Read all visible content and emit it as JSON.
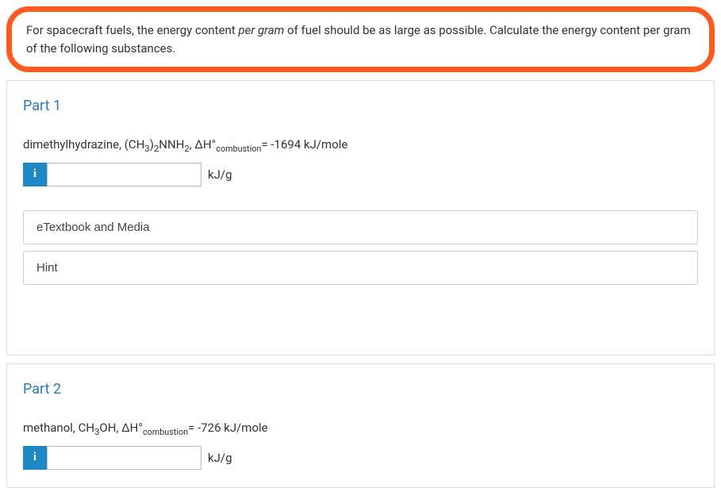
{
  "question": {
    "pre": "For spacecraft fuels, the energy content ",
    "italic": "per gram",
    "post": " of fuel should be as large as possible. Calculate the energy content per gram of the following substances."
  },
  "part1": {
    "heading": "Part 1",
    "substance_pre": "dimethylhydrazine, (CH",
    "sub1": "3",
    "mid1": ")",
    "sub2": "2",
    "mid2": "NNH",
    "sub3": "2",
    "mid3": ", ΔH°",
    "combustion_label": "combustion",
    "value_eq": "= -1694 kJ/mole",
    "info_symbol": "i",
    "unit": "kJ/g",
    "etextbook_label": "eTextbook and Media",
    "hint_label": "Hint"
  },
  "part2": {
    "heading": "Part 2",
    "substance_pre": "methanol, CH",
    "sub1": "3",
    "mid1": "OH, ΔH°",
    "combustion_label": "combustion",
    "value_eq": "= -726 kJ/mole",
    "info_symbol": "i",
    "unit": "kJ/g"
  }
}
